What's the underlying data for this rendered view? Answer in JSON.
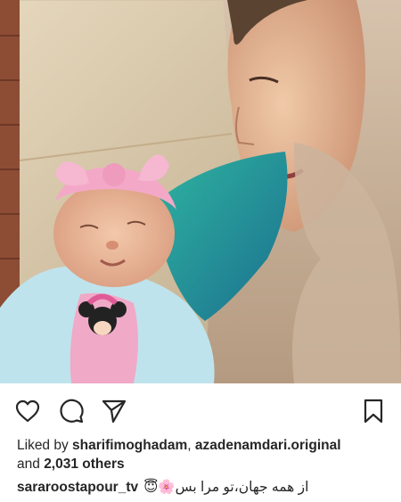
{
  "post": {
    "photo_alt": "",
    "actions": {
      "like_icon": "heart-icon",
      "comment_icon": "comment-bubble-icon",
      "share_icon": "paper-plane-icon",
      "save_icon": "bookmark-icon"
    },
    "likes": {
      "prefix": "Liked by",
      "user1": "sharifimoghadam",
      "separator": ",",
      "user2": "azadenamdari.original",
      "and_text": "and",
      "others_count": "2,031 others"
    },
    "caption": {
      "username": "sararoostapour_tv",
      "text": "😇🌸از همه جهان،تو مرا بس"
    }
  }
}
